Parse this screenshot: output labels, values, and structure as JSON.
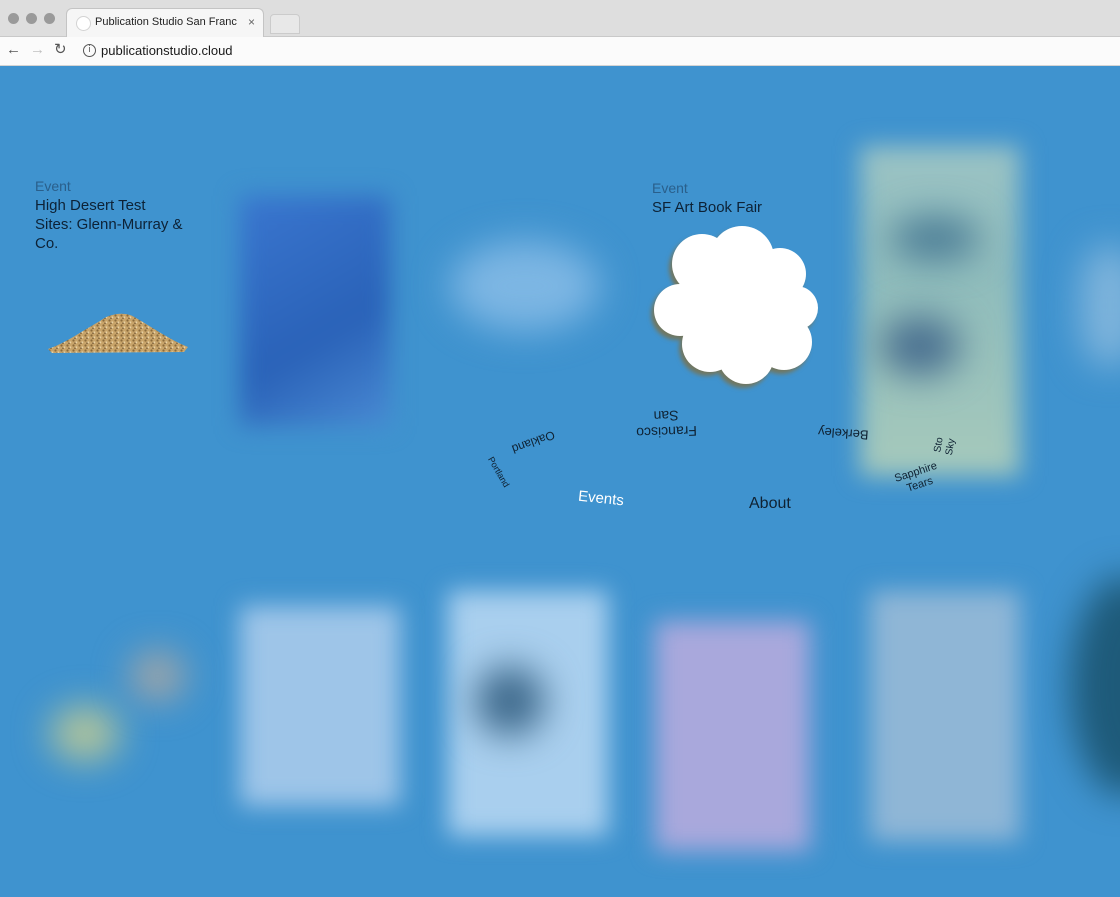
{
  "browser": {
    "tab_title": "Publication Studio San Francis",
    "tab_close": "×",
    "url": "publicationstudio.cloud",
    "info_symbol": "i"
  },
  "events": [
    {
      "kind": "Event",
      "title_lines": [
        "High Desert Test",
        "Sites: Glenn-Murray &",
        "Co."
      ]
    },
    {
      "kind": "Event",
      "title": "SF Art Book Fair"
    }
  ],
  "menu": {
    "locations": {
      "san_francisco_lines": [
        "San",
        "Francisco"
      ],
      "oakland": "Oakland",
      "portland_small": "Portland",
      "berkeley": "Berkeley",
      "sapphire_tears_lines": [
        "Sapphire",
        "Tears"
      ],
      "side_small_lines": [
        "Sto",
        "Sky"
      ]
    },
    "events_link": "Events",
    "about_link": "About"
  },
  "colors": {
    "page_background": "#3f93cf",
    "menu_active": "#ffffff",
    "menu_text": "#0f2233"
  }
}
